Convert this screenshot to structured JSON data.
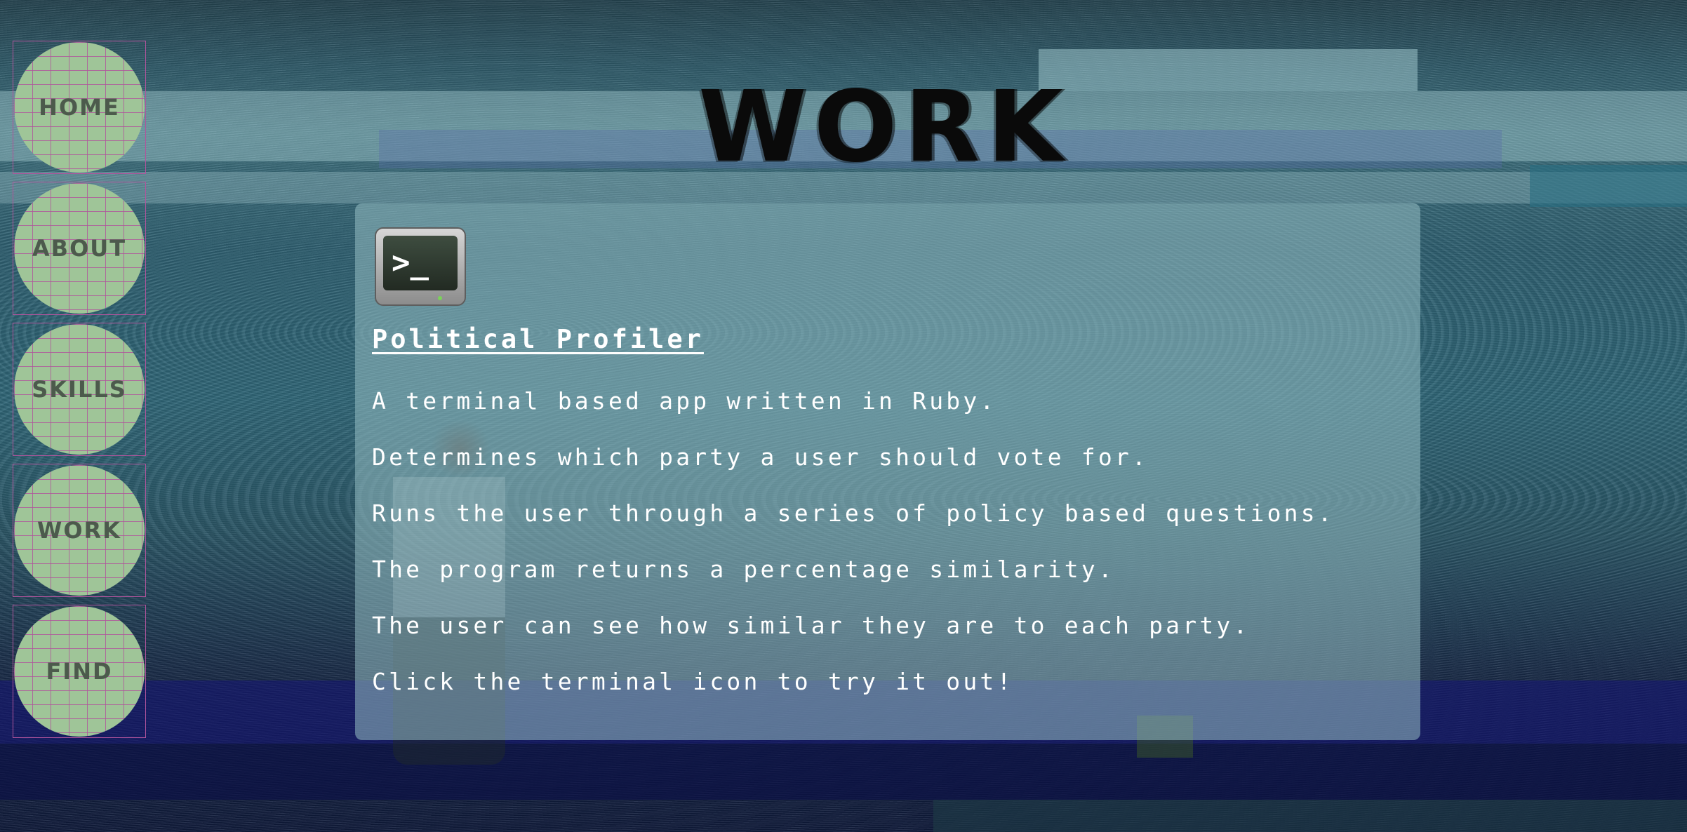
{
  "nav": {
    "items": [
      {
        "label": "HOME"
      },
      {
        "label": "ABOUT"
      },
      {
        "label": "SKILLS"
      },
      {
        "label": "WORK"
      },
      {
        "label": "FIND"
      }
    ]
  },
  "page": {
    "title": "WORK"
  },
  "project": {
    "icon": "terminal-icon",
    "icon_glyph": ">_",
    "title": "Political Profiler",
    "lines": [
      "A terminal based app written in Ruby.",
      "Determines which party a user should vote for.",
      "Runs the user through a series of policy based questions.",
      "The program returns a percentage similarity.",
      "The user can see how similar they are to each party.",
      "Click the terminal icon to try it out!"
    ]
  },
  "colors": {
    "nav_button": "#9fc598",
    "nav_grid": "#b0549c",
    "nav_text": "#4c5a4c",
    "title": "#0a0a0a",
    "card_text": "#ffffff"
  }
}
